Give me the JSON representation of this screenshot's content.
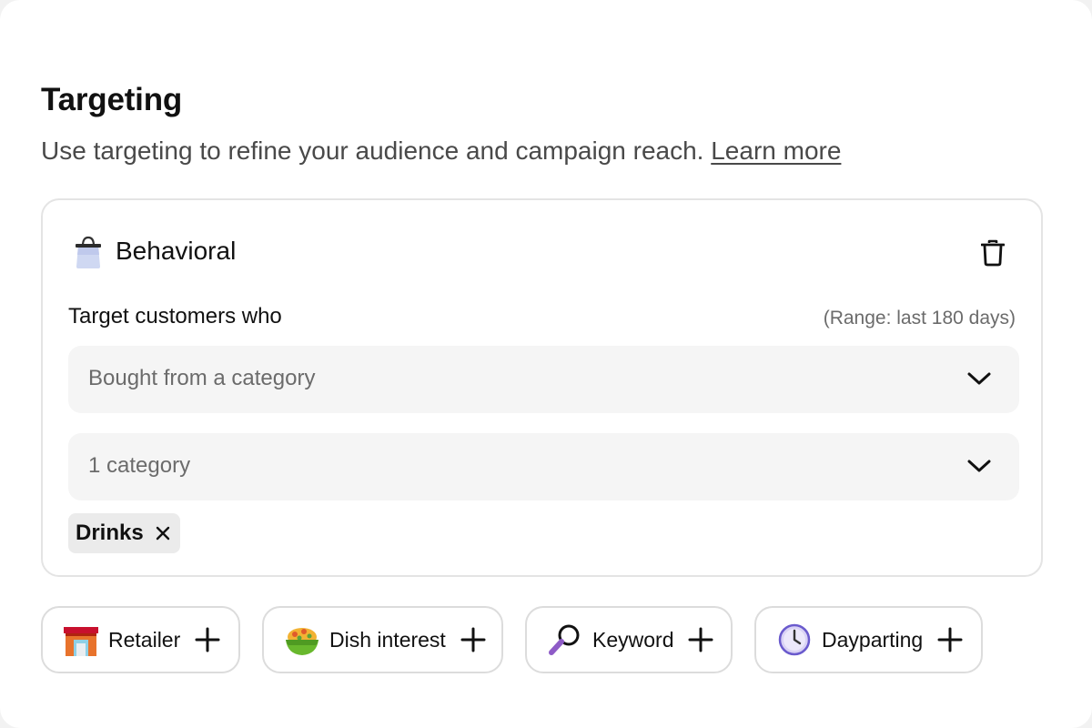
{
  "section": {
    "title": "Targeting",
    "subtitle": "Use targeting to refine your audience and campaign reach.",
    "learn_more": "Learn more"
  },
  "card": {
    "icon": "shopping-bag-icon",
    "title": "Behavioral",
    "delete_icon": "trash-icon",
    "field_label": "Target customers who",
    "range_note": "(Range: last 180 days)",
    "action_select": {
      "value": "Bought from a category"
    },
    "category_select": {
      "value": "1 category"
    },
    "chips": [
      {
        "label": "Drinks",
        "remove_icon": "close-icon"
      }
    ]
  },
  "add_buttons": [
    {
      "label": "Retailer",
      "icon": "storefront-icon"
    },
    {
      "label": "Dish interest",
      "icon": "food-bowl-icon"
    },
    {
      "label": "Keyword",
      "icon": "magnifier-icon"
    },
    {
      "label": "Dayparting",
      "icon": "clock-icon"
    }
  ],
  "colors": {
    "text": "#191919",
    "muted": "#6b6b6b",
    "field_bg": "#f5f5f5",
    "chip_bg": "#ebebeb",
    "border": "#e4e4e4"
  }
}
